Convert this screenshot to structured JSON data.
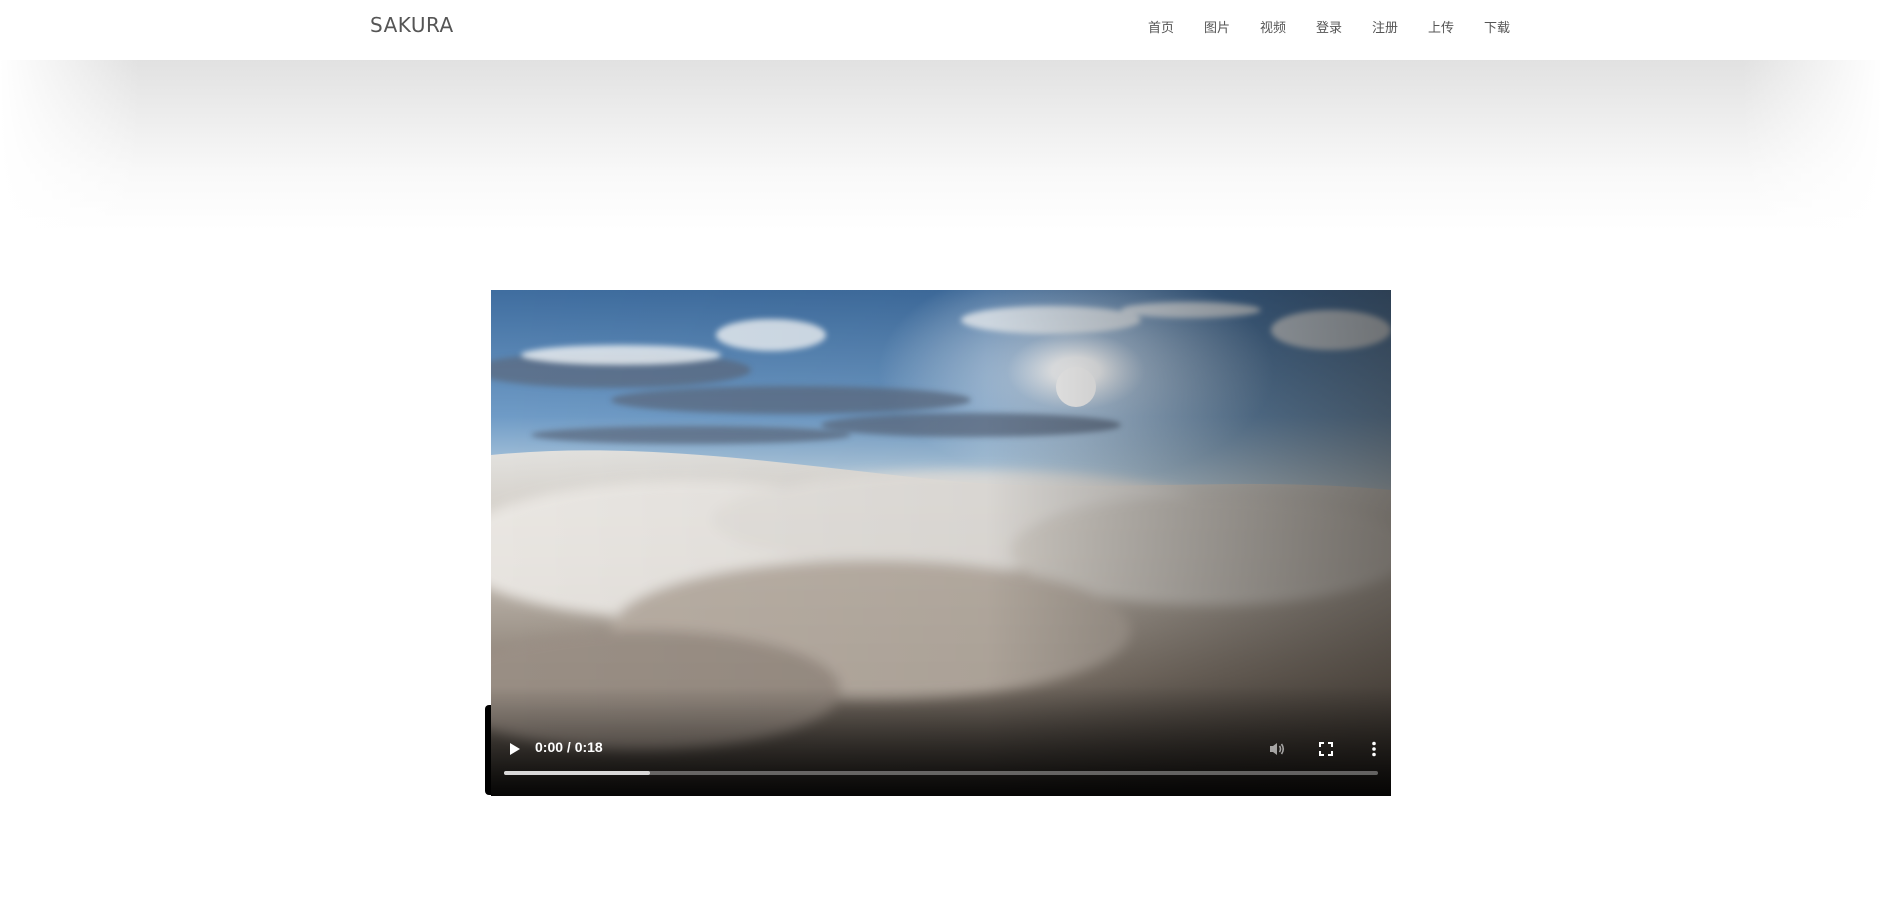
{
  "site": {
    "brand": "SAKURA"
  },
  "nav": {
    "items": [
      {
        "label": "首页"
      },
      {
        "label": "图片"
      },
      {
        "label": "视频"
      },
      {
        "label": "登录"
      },
      {
        "label": "注册"
      },
      {
        "label": "上传"
      },
      {
        "label": "下载"
      }
    ]
  },
  "video": {
    "time_display": "0:00 / 0:18",
    "buffered_fraction": 0.167,
    "icons": {
      "play": "play-icon",
      "mute": "volume-icon",
      "fullscreen": "fullscreen-icon",
      "more": "more-options-icon"
    }
  }
}
